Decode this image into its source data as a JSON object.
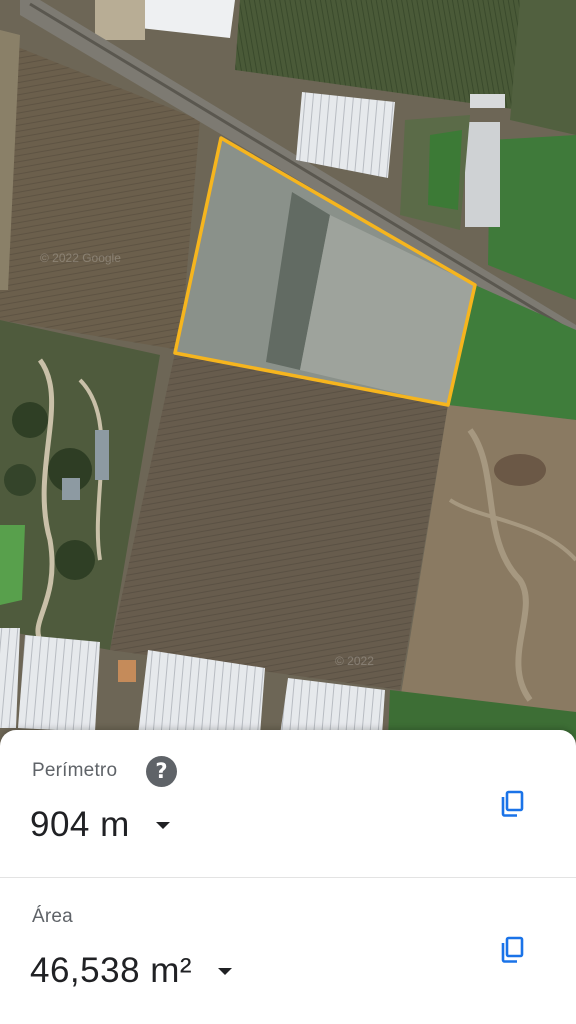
{
  "map": {
    "watermark_1": "© 2022 Google",
    "watermark_2": "© 2022"
  },
  "measurement": {
    "perimeter": {
      "label": "Perímetro",
      "value": "904 m",
      "help_icon": "help-circle-icon",
      "copy_icon": "copy-icon"
    },
    "area": {
      "label": "Área",
      "value": "46,538 m²",
      "copy_icon": "copy-icon"
    }
  },
  "colors": {
    "polygon_outline": "#f6b51e",
    "copy_icon": "#1a73e8",
    "text_primary": "#202124",
    "text_secondary": "#5f6368"
  }
}
